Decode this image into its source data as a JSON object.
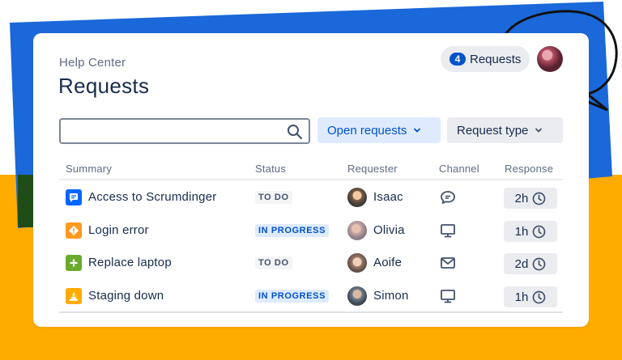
{
  "colors": {
    "blue_bg": "#1a68d9",
    "yellow_bg": "#ffab00",
    "accent": "#0052cc"
  },
  "breadcrumb": "Help Center",
  "page_title": "Requests",
  "requests_pill": {
    "count": "4",
    "label": "Requests"
  },
  "search": {
    "placeholder": ""
  },
  "filters": {
    "open_requests": "Open requests",
    "request_type": "Request type"
  },
  "table": {
    "headers": [
      "Summary",
      "Status",
      "Requester",
      "Channel",
      "Response"
    ],
    "rows": [
      {
        "summary": "Access to Scrumdinger",
        "type_icon": "chat-square-icon",
        "status": "TO DO",
        "requester": "Isaac",
        "channel_icon": "chat-bubble-icon",
        "response": "2h"
      },
      {
        "summary": "Login error",
        "type_icon": "alert-icon",
        "status": "IN PROGRESS",
        "requester": "Olivia",
        "channel_icon": "monitor-icon",
        "response": "1h"
      },
      {
        "summary": "Replace laptop",
        "type_icon": "plus-icon",
        "status": "TO DO",
        "requester": "Aoife",
        "channel_icon": "mail-icon",
        "response": "2d"
      },
      {
        "summary": "Staging down",
        "type_icon": "cone-icon",
        "status": "IN PROGRESS",
        "requester": "Simon",
        "channel_icon": "monitor-icon",
        "response": "1h"
      }
    ]
  }
}
